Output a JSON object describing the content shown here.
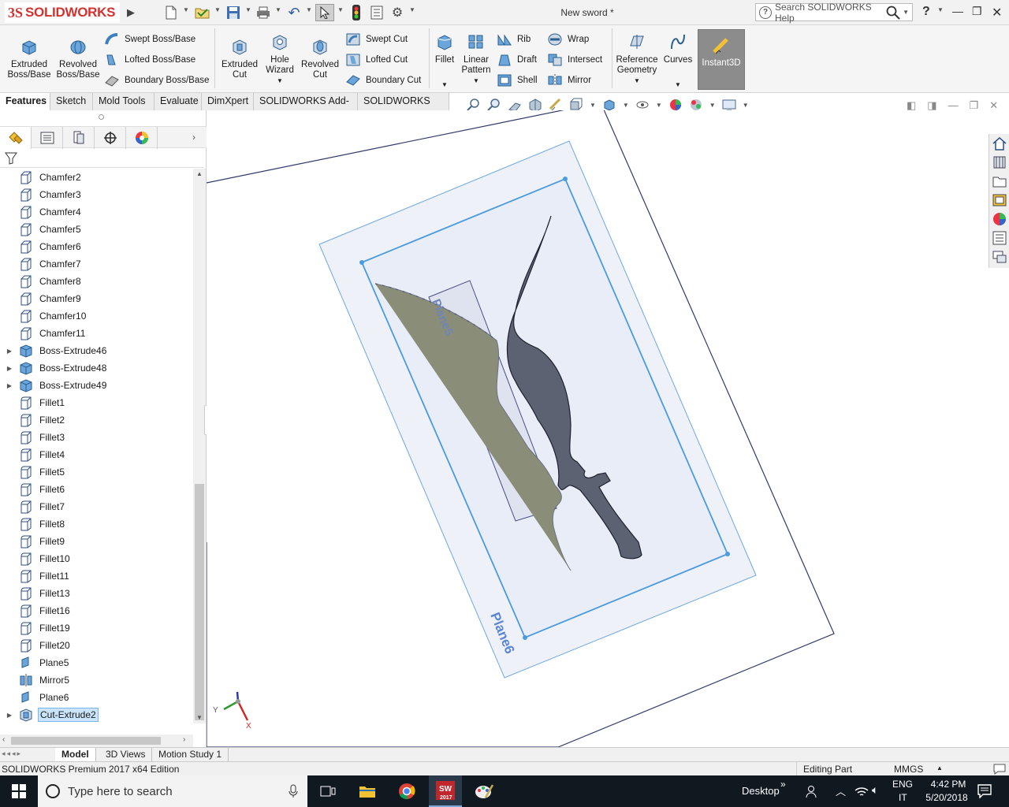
{
  "app": {
    "logo_ds": "3S",
    "logo_text": "SOLIDWORKS",
    "doc_title": "New sword *"
  },
  "search": {
    "placeholder": "Search SOLIDWORKS Help"
  },
  "help": "?",
  "ribbon": {
    "extruded_boss": "Extruded Boss/Base",
    "revolved_boss": "Revolved Boss/Base",
    "swept_boss": "Swept Boss/Base",
    "lofted_boss": "Lofted Boss/Base",
    "boundary_boss": "Boundary Boss/Base",
    "extruded_cut": "Extruded Cut",
    "hole_wizard": "Hole Wizard",
    "revolved_cut": "Revolved Cut",
    "swept_cut": "Swept Cut",
    "lofted_cut": "Lofted Cut",
    "boundary_cut": "Boundary Cut",
    "fillet": "Fillet",
    "linear_pattern": "Linear Pattern",
    "rib": "Rib",
    "draft": "Draft",
    "shell": "Shell",
    "wrap": "Wrap",
    "intersect": "Intersect",
    "mirror": "Mirror",
    "reference_geometry": "Reference Geometry",
    "curves": "Curves",
    "instant3d": "Instant3D"
  },
  "tabs": [
    "Features",
    "Sketch",
    "Mold Tools",
    "Evaluate",
    "DimXpert",
    "SOLIDWORKS Add-Ins",
    "SOLIDWORKS MBD"
  ],
  "tree": [
    {
      "label": "Chamfer2",
      "icon": "chamfer-icon",
      "expandable": false
    },
    {
      "label": "Chamfer3",
      "icon": "chamfer-icon",
      "expandable": false
    },
    {
      "label": "Chamfer4",
      "icon": "chamfer-icon",
      "expandable": false
    },
    {
      "label": "Chamfer5",
      "icon": "chamfer-icon",
      "expandable": false
    },
    {
      "label": "Chamfer6",
      "icon": "chamfer-icon",
      "expandable": false
    },
    {
      "label": "Chamfer7",
      "icon": "chamfer-icon",
      "expandable": false
    },
    {
      "label": "Chamfer8",
      "icon": "chamfer-icon",
      "expandable": false
    },
    {
      "label": "Chamfer9",
      "icon": "chamfer-icon",
      "expandable": false
    },
    {
      "label": "Chamfer10",
      "icon": "chamfer-icon",
      "expandable": false
    },
    {
      "label": "Chamfer11",
      "icon": "chamfer-icon",
      "expandable": false
    },
    {
      "label": "Boss-Extrude46",
      "icon": "boss-extrude-icon",
      "expandable": true
    },
    {
      "label": "Boss-Extrude48",
      "icon": "boss-extrude-icon",
      "expandable": true
    },
    {
      "label": "Boss-Extrude49",
      "icon": "boss-extrude-icon",
      "expandable": true
    },
    {
      "label": "Fillet1",
      "icon": "fillet-icon",
      "expandable": false
    },
    {
      "label": "Fillet2",
      "icon": "fillet-icon",
      "expandable": false
    },
    {
      "label": "Fillet3",
      "icon": "fillet-icon",
      "expandable": false
    },
    {
      "label": "Fillet4",
      "icon": "fillet-icon",
      "expandable": false
    },
    {
      "label": "Fillet5",
      "icon": "fillet-icon",
      "expandable": false
    },
    {
      "label": "Fillet6",
      "icon": "fillet-icon",
      "expandable": false
    },
    {
      "label": "Fillet7",
      "icon": "fillet-icon",
      "expandable": false
    },
    {
      "label": "Fillet8",
      "icon": "fillet-icon",
      "expandable": false
    },
    {
      "label": "Fillet9",
      "icon": "fillet-icon",
      "expandable": false
    },
    {
      "label": "Fillet10",
      "icon": "fillet-icon",
      "expandable": false
    },
    {
      "label": "Fillet11",
      "icon": "fillet-icon",
      "expandable": false
    },
    {
      "label": "Fillet13",
      "icon": "fillet-icon",
      "expandable": false
    },
    {
      "label": "Fillet16",
      "icon": "fillet-icon",
      "expandable": false
    },
    {
      "label": "Fillet19",
      "icon": "fillet-icon",
      "expandable": false
    },
    {
      "label": "Fillet20",
      "icon": "fillet-icon",
      "expandable": false
    },
    {
      "label": "Plane5",
      "icon": "plane-icon",
      "expandable": false
    },
    {
      "label": "Mirror5",
      "icon": "mirror-icon",
      "expandable": false
    },
    {
      "label": "Plane6",
      "icon": "plane-icon",
      "expandable": false
    },
    {
      "label": "Cut-Extrude2",
      "icon": "cut-extrude-icon",
      "expandable": true,
      "selected": true
    }
  ],
  "viewport": {
    "plane6_label": "Plane6",
    "plane5_label": "Plane5",
    "axis_y": "Y",
    "axis_x": "X"
  },
  "bottom_tabs": [
    "Model",
    "3D Views",
    "Motion Study 1"
  ],
  "status": {
    "left": "SOLIDWORKS Premium 2017 x64 Edition",
    "mode": "Editing Part",
    "units": "MMGS"
  },
  "taskbar": {
    "search_placeholder": "Type here to search",
    "desktop": "Desktop",
    "lang": "ENG",
    "lang2": "IT",
    "time": "4:42 PM",
    "date": "5/20/2018",
    "sw_label": "2017"
  },
  "colors": {
    "accent_blue": "#4a9be0",
    "plane_fill": "#e8eef8",
    "sword_fill": "#5d6272",
    "selection": "#c9e4fb",
    "logo_red": "#d3322f"
  }
}
